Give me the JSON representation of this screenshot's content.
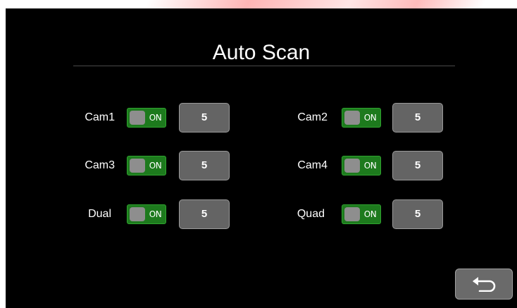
{
  "page": {
    "title": "Auto Scan"
  },
  "colors": {
    "background": "#000000",
    "toggle_on": "#1d7a1d",
    "button": "#646464"
  },
  "channels": [
    {
      "label": "Cam1",
      "toggle": "ON",
      "value": "5"
    },
    {
      "label": "Cam2",
      "toggle": "ON",
      "value": "5"
    },
    {
      "label": "Cam3",
      "toggle": "ON",
      "value": "5"
    },
    {
      "label": "Cam4",
      "toggle": "ON",
      "value": "5"
    },
    {
      "label": "Dual",
      "toggle": "ON",
      "value": "5"
    },
    {
      "label": "Quad",
      "toggle": "ON",
      "value": "5"
    }
  ],
  "back_button": {
    "icon": "return-arrow-icon"
  }
}
